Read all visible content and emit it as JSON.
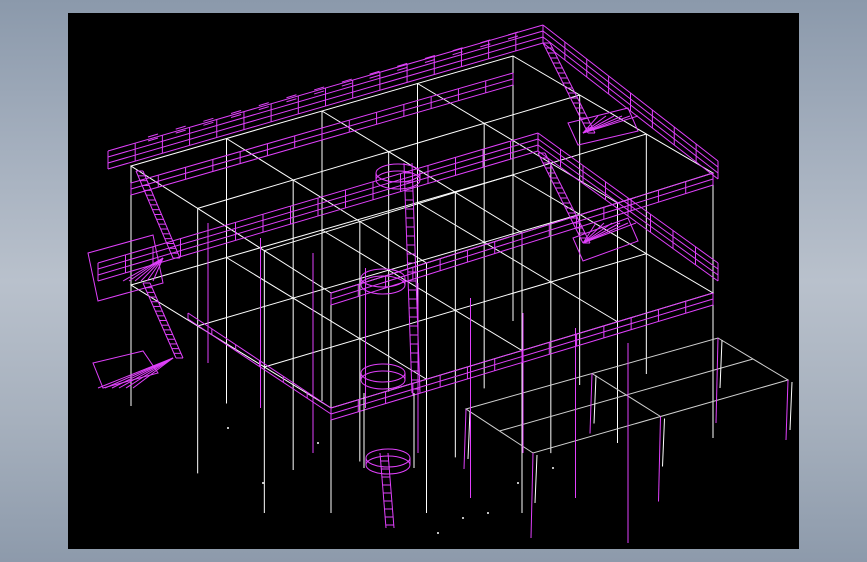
{
  "colors": {
    "background": "#000000",
    "frame_gradient": "#a3aebd",
    "structure": "#ffffff",
    "railings": "#e040fb"
  },
  "view": {
    "type": "3d-wireframe"
  }
}
